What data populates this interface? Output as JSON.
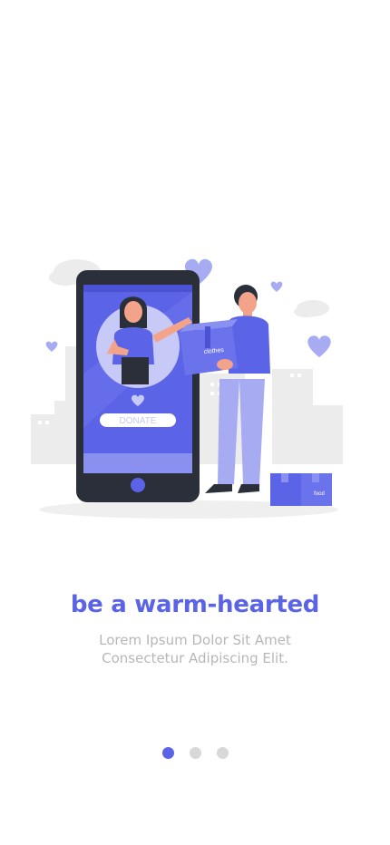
{
  "onboarding": {
    "title": "be a warm-hearted",
    "subtitle_lines": [
      "Lorem Ipsum Dolor Sit Amet",
      "Consectetur Adipiscing Elit."
    ],
    "illustration": {
      "donate_label": "DONATE",
      "box_label": "clothes",
      "small_box_label": "food"
    }
  },
  "pager": {
    "count": 3,
    "active_index": 0
  },
  "colors": {
    "accent": "#5b63e6",
    "inactive_dot": "#d8d8d8",
    "subtitle": "#b7b7b7"
  }
}
